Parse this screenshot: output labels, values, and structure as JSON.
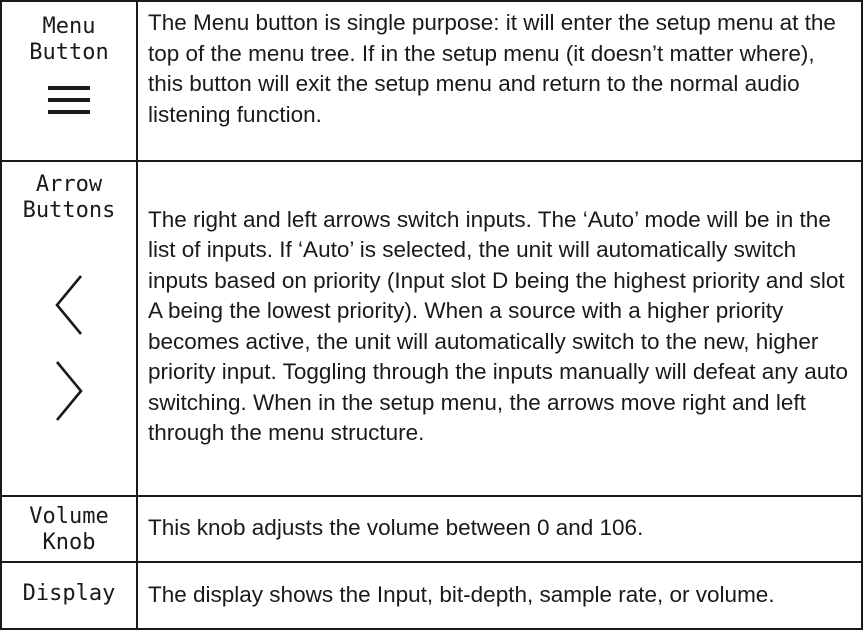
{
  "rows": [
    {
      "label": [
        "Menu",
        "Button"
      ],
      "icon": "hamburger-menu-icon",
      "description": "The Menu button is single purpose: it will enter the setup menu at the top of the menu tree.  If in the setup menu (it doesn’t matter where), this button will exit the setup menu and return to the normal audio listening function."
    },
    {
      "label": [
        "Arrow",
        "Buttons"
      ],
      "icon": [
        "chevron-left-icon",
        "chevron-right-icon"
      ],
      "description": "The right and left arrows switch inputs. The ‘Auto’ mode will be in the list of inputs. If ‘Auto’ is selected, the unit will automatically switch inputs based on priority (Input slot D being the highest priority and slot A being the lowest priority). When a source with a higher priority becomes active, the unit will automatically switch to the new, higher priority input.  Toggling through the inputs manually will defeat any auto switching. When in the setup menu, the arrows move right and left through the menu structure."
    },
    {
      "label": [
        "Volume",
        "Knob"
      ],
      "description": "This knob adjusts the volume between 0 and 106."
    },
    {
      "label": [
        "Display"
      ],
      "description": "The display shows the Input, bit-depth, sample rate, or volume."
    }
  ],
  "colors": {
    "text": "#1a1a1a",
    "border": "#1a1a1a",
    "background": "#ffffff"
  }
}
